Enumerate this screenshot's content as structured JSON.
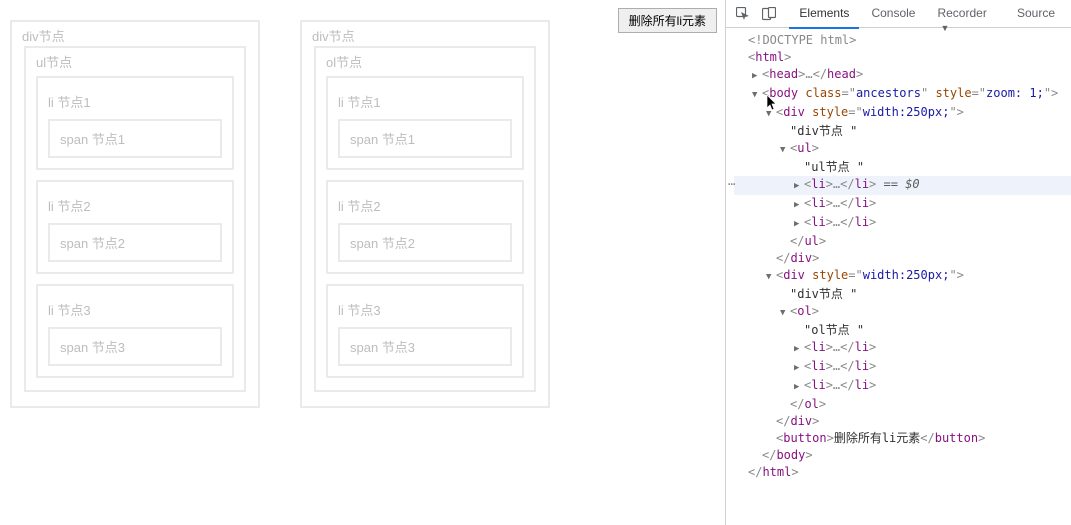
{
  "preview": {
    "div_label": "div节点",
    "ul_label": "ul节点",
    "ol_label": "ol节点",
    "li1": "li 节点1",
    "li2": "li 节点2",
    "li3": "li 节点3",
    "span1": "span 节点1",
    "span2": "span 节点2",
    "span3": "span 节点3",
    "delete_btn": "删除所有li元素"
  },
  "devtools": {
    "tabs": {
      "elements": "Elements",
      "console": "Console",
      "recorder": "Recorder",
      "sources": "Source"
    },
    "dom": {
      "doctype": "<!DOCTYPE html>",
      "html_open": "html",
      "head_collapsed": "head",
      "body_open_tag": "body",
      "body_cls_name": "class",
      "body_cls_val": "ancestors",
      "body_style_name": "style",
      "body_style_val": "zoom: 1;",
      "div1_style_val": "width:250px;",
      "div1_text": "\"div节点 \"",
      "ul_tag": "ul",
      "ul_text": "\"ul节点 \"",
      "li_tag": "li",
      "eq0": "== $0",
      "div2_style_val": "width:250px;",
      "div2_text": "\"div节点 \"",
      "ol_tag": "ol",
      "ol_text": "\"ol节点 \"",
      "button_tag": "button",
      "button_text": "删除所有li元素"
    }
  }
}
